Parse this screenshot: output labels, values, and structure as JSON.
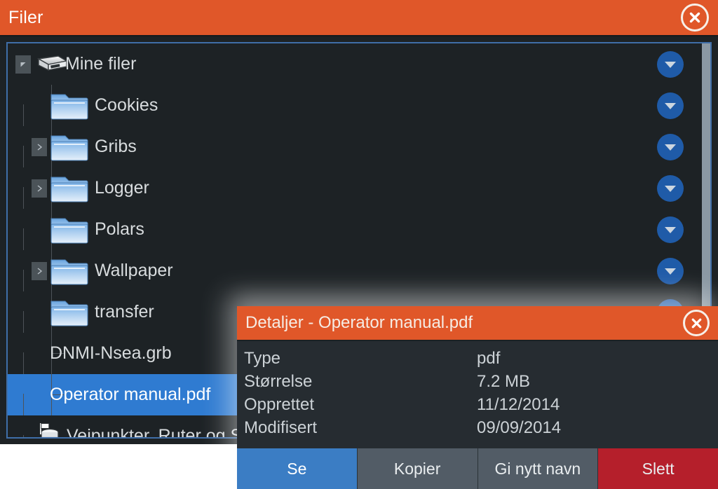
{
  "window": {
    "title": "Filer",
    "close_icon": "close-circle-x-icon",
    "accent_orange": "#e05729",
    "panel_bg": "#1d2225",
    "panel_border": "#3f6ea8",
    "selection_blue": "#2f7bd1"
  },
  "tree": {
    "dropdown_icon": "chevron-down-icon",
    "expand_icon": "triangle-expanded-icon",
    "collapse_icon": "triangle-collapsed-icon",
    "items": [
      {
        "label": "Mine filer",
        "icon": "drive-icon",
        "level": 0,
        "toggle": "expanded",
        "selected": false,
        "has_dropdown": true
      },
      {
        "label": "Cookies",
        "icon": "folder-icon",
        "level": 1,
        "toggle": "none",
        "selected": false,
        "has_dropdown": true
      },
      {
        "label": "Gribs",
        "icon": "folder-icon",
        "level": 1,
        "toggle": "collapsed",
        "selected": false,
        "has_dropdown": true
      },
      {
        "label": "Logger",
        "icon": "folder-icon",
        "level": 1,
        "toggle": "collapsed",
        "selected": false,
        "has_dropdown": true
      },
      {
        "label": "Polars",
        "icon": "folder-icon",
        "level": 1,
        "toggle": "none",
        "selected": false,
        "has_dropdown": true
      },
      {
        "label": "Wallpaper",
        "icon": "folder-icon",
        "level": 1,
        "toggle": "collapsed",
        "selected": false,
        "has_dropdown": true
      },
      {
        "label": "transfer",
        "icon": "folder-icon",
        "level": 1,
        "toggle": "none",
        "selected": false,
        "has_dropdown": true
      },
      {
        "label": "DNMI-Nsea.grb",
        "icon": "none",
        "level": 1,
        "toggle": "none",
        "selected": false,
        "has_dropdown": true
      },
      {
        "label": "Operator manual.pdf",
        "icon": "none",
        "level": 1,
        "toggle": "none",
        "selected": true,
        "has_dropdown": true
      },
      {
        "label": "Veipunkter, Ruter og Spor",
        "icon": "database-flag-icon",
        "level": 0,
        "toggle": "none",
        "selected": false,
        "has_dropdown": true
      }
    ]
  },
  "details_dialog": {
    "title": "Detaljer - Operator manual.pdf",
    "close_icon": "close-circle-x-icon",
    "rows": [
      {
        "key": "Type",
        "value": "pdf"
      },
      {
        "key": "Størrelse",
        "value": "7.2 MB"
      },
      {
        "key": "Opprettet",
        "value": "11/12/2014"
      },
      {
        "key": "Modifisert",
        "value": "09/09/2014"
      }
    ],
    "buttons": [
      {
        "label": "Se",
        "style": "primary"
      },
      {
        "label": "Kopier",
        "style": "neutral"
      },
      {
        "label": "Gi nytt navn",
        "style": "neutral"
      },
      {
        "label": "Slett",
        "style": "danger"
      }
    ]
  }
}
